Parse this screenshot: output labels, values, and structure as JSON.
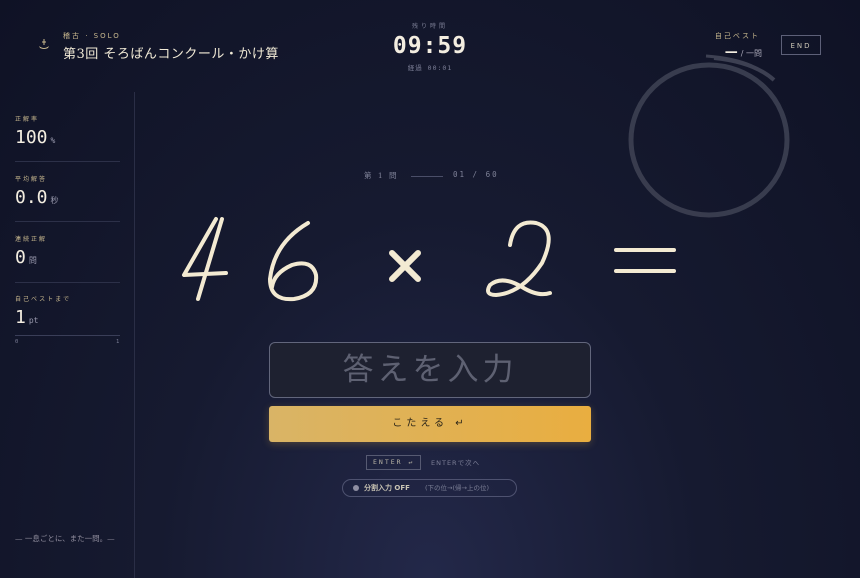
{
  "header": {
    "mode": "稽古 · SOLO",
    "title": "第3回 そろばんコンクール・かけ算",
    "timer_label": "残り時間",
    "timer": "09:59",
    "elapsed": "経過 00:01",
    "best_label": "自己ベスト",
    "best_value": "—",
    "best_unit": "/ 一問",
    "end_label": "END"
  },
  "sidebar": {
    "accuracy_label": "正解率",
    "accuracy_value": "100",
    "accuracy_unit": "%",
    "avg_label": "平均解答",
    "avg_value": "0.0",
    "avg_unit": "秒",
    "streak_label": "連続正解",
    "streak_value": "0",
    "streak_unit": "問",
    "to_best_label": "自己ベストまで",
    "to_best_value": "1",
    "to_best_unit": "pt",
    "progress_min": "0",
    "progress_max": "1",
    "progress_fraction": 0,
    "footnote": "— 一息ごとに、また一問。—"
  },
  "question": {
    "label": "第 1 問",
    "count": "01 / 60",
    "operand_a": "46",
    "operator": "×",
    "operand_b": "2",
    "equals": "="
  },
  "answer": {
    "placeholder": "答えを入力",
    "submit_label": "こたえる ↵"
  },
  "hints": {
    "enter_key": "ENTER ↵",
    "enter_hint": "ENTERで次へ",
    "split_label": "分割入力 OFF",
    "split_hint": "(下の位→(帰→上の位)"
  },
  "colors": {
    "accent": "#e9ae40",
    "gold_text": "#c9b98f",
    "chalk": "#f3ead2"
  }
}
